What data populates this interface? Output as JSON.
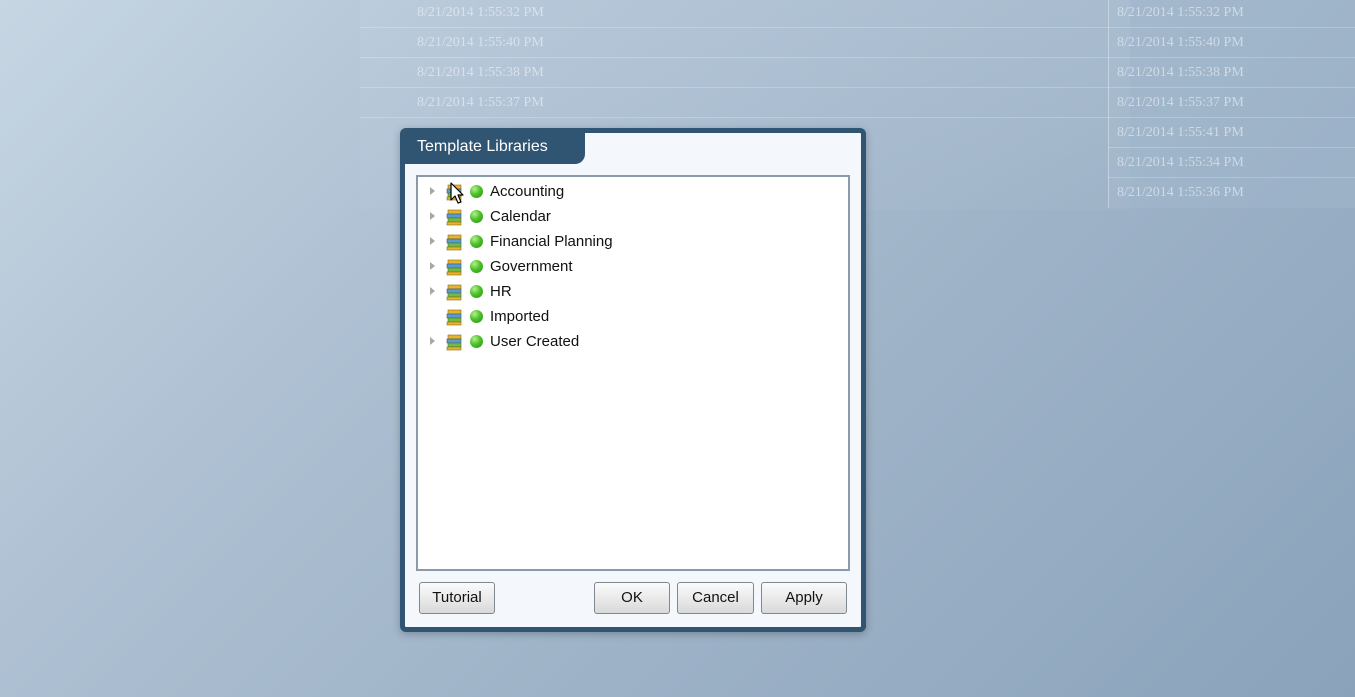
{
  "background": {
    "left_column_times": [
      "8/21/2014 1:55:32 PM",
      "8/21/2014 1:55:40 PM",
      "8/21/2014 1:55:38 PM",
      "8/21/2014 1:55:37 PM"
    ],
    "right_column_times": [
      "8/21/2014 1:55:32 PM",
      "8/21/2014 1:55:40 PM",
      "8/21/2014 1:55:38 PM",
      "8/21/2014 1:55:37 PM",
      "8/21/2014 1:55:41 PM",
      "8/21/2014 1:55:34 PM",
      "8/21/2014 1:55:36 PM"
    ]
  },
  "dialog": {
    "title": "Template Libraries",
    "libraries": [
      {
        "label": "Accounting",
        "expandable": true,
        "icon": "library-books-icon",
        "status": "green"
      },
      {
        "label": "Calendar",
        "expandable": true,
        "icon": "library-books-icon",
        "status": "green"
      },
      {
        "label": "Financial Planning",
        "expandable": true,
        "icon": "library-books-icon",
        "status": "green"
      },
      {
        "label": "Government",
        "expandable": true,
        "icon": "library-books-icon",
        "status": "green"
      },
      {
        "label": "HR",
        "expandable": true,
        "icon": "library-books-icon",
        "status": "green"
      },
      {
        "label": "Imported",
        "expandable": false,
        "icon": "library-books-icon",
        "status": "green"
      },
      {
        "label": "User Created",
        "expandable": true,
        "icon": "library-books-icon",
        "status": "green"
      }
    ],
    "buttons": {
      "tutorial": "Tutorial",
      "ok": "OK",
      "cancel": "Cancel",
      "apply": "Apply"
    }
  },
  "colors": {
    "dialog_frame": "#2f5573",
    "status_green": "#4cc22a"
  }
}
